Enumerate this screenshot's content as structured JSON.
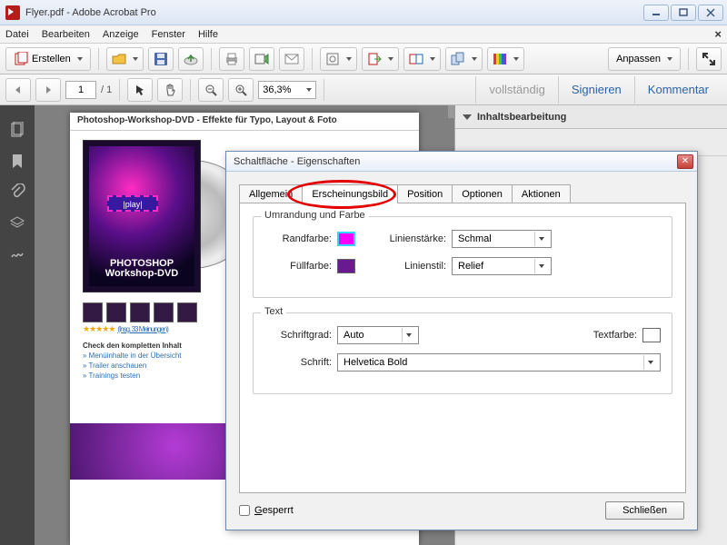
{
  "window": {
    "title": "Flyer.pdf - Adobe Acrobat Pro"
  },
  "menubar": {
    "items": [
      "Datei",
      "Bearbeiten",
      "Anzeige",
      "Fenster",
      "Hilfe"
    ]
  },
  "toolbar": {
    "create_label": "Erstellen",
    "customize_label": "Anpassen"
  },
  "nav": {
    "page_current": "1",
    "page_total": "/ 1",
    "zoom": "36,3%"
  },
  "side_actions": {
    "full": "vollständig",
    "sign": "Signieren",
    "comment": "Kommentar"
  },
  "right_panel": {
    "section": "Inhaltsbearbeitung"
  },
  "document": {
    "header": "Photoshop-Workshop-DVD - Effekte für Typo, Layout & Foto",
    "play_label": "|play|",
    "dvd_title_1": "PHOTOSHOP",
    "dvd_title_2": "Workshop-DVD",
    "rating_link": "(Insg. 33 Meinungen)",
    "check_title": "Check den kompletten Inhalt",
    "links": [
      "» Menüinhalte in der Übersicht",
      "» Trailer anschauen",
      "» Trainings testen"
    ]
  },
  "dialog": {
    "title": "Schaltfläche - Eigenschaften",
    "tabs": [
      "Allgemein",
      "Erscheinungsbild",
      "Position",
      "Optionen",
      "Aktionen"
    ],
    "active_tab": 1,
    "group_border": "Umrandung und Farbe",
    "group_text": "Text",
    "lbl_border_color": "Randfarbe:",
    "lbl_fill_color": "Füllfarbe:",
    "lbl_line_weight": "Linienstärke:",
    "lbl_line_style": "Linienstil:",
    "val_line_weight": "Schmal",
    "val_line_style": "Relief",
    "lbl_font_size": "Schriftgrad:",
    "lbl_font": "Schrift:",
    "lbl_text_color": "Textfarbe:",
    "val_font_size": "Auto",
    "val_font": "Helvetica Bold",
    "locked": "Gesperrt",
    "close": "Schließen"
  }
}
